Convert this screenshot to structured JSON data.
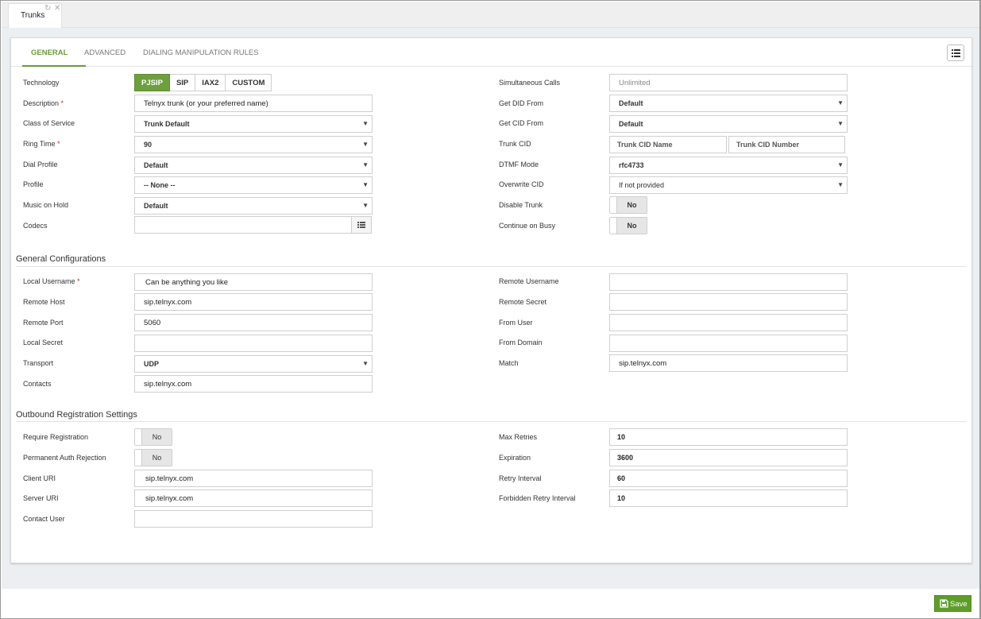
{
  "window": {
    "tab_title": "Trunks",
    "tab_icons": [
      "refresh-icon",
      "close-icon"
    ]
  },
  "tabs": [
    {
      "label": "GENERAL",
      "active": true
    },
    {
      "label": "ADVANCED",
      "active": false
    },
    {
      "label": "DIALING MANIPULATION RULES",
      "active": false
    }
  ],
  "left": {
    "technology": {
      "label": "Technology",
      "options": [
        "PJSIP",
        "SIP",
        "IAX2",
        "CUSTOM"
      ],
      "selected": "PJSIP"
    },
    "description": {
      "label": "Description",
      "required": "*",
      "value": "Telnyx trunk (or your preferred name)"
    },
    "class_of_service": {
      "label": "Class of Service",
      "value": "Trunk Default"
    },
    "ring_time": {
      "label": "Ring Time",
      "required": "*",
      "value": "90"
    },
    "dial_profile": {
      "label": "Dial Profile",
      "value": "Default"
    },
    "profile": {
      "label": "Profile",
      "value": "-- None --"
    },
    "music_on_hold": {
      "label": "Music on Hold",
      "value": "Default"
    },
    "codecs": {
      "label": "Codecs",
      "value": ""
    }
  },
  "right": {
    "simultaneous_calls": {
      "label": "Simultaneous Calls",
      "placeholder": "Unlimited"
    },
    "get_did_from": {
      "label": "Get DID From",
      "value": "Default"
    },
    "get_cid_from": {
      "label": "Get CID From",
      "value": "Default"
    },
    "trunk_cid": {
      "label": "Trunk CID",
      "name_placeholder": "Trunk CID Name",
      "number_placeholder": "Trunk CID Number"
    },
    "dtmf_mode": {
      "label": "DTMF Mode",
      "value": "rfc4733"
    },
    "overwrite_cid": {
      "label": "Overwrite CID",
      "value": "If not provided"
    },
    "disable_trunk": {
      "label": "Disable Trunk",
      "value": "No"
    },
    "continue_on_busy": {
      "label": "Continue on Busy",
      "value": "No"
    }
  },
  "general_config": {
    "title": "General Configurations",
    "local_username": {
      "label": "Local Username",
      "required": "*",
      "value": "Can be anything you like"
    },
    "remote_host": {
      "label": "Remote Host",
      "value": "sip.telnyx.com"
    },
    "remote_port": {
      "label": "Remote Port",
      "value": "5060"
    },
    "local_secret": {
      "label": "Local Secret",
      "value": ""
    },
    "transport": {
      "label": "Transport",
      "value": "UDP"
    },
    "contacts": {
      "label": "Contacts",
      "value": "sip.telnyx.com"
    },
    "remote_username": {
      "label": "Remote Username",
      "value": ""
    },
    "remote_secret": {
      "label": "Remote Secret",
      "value": ""
    },
    "from_user": {
      "label": "From User",
      "value": ""
    },
    "from_domain": {
      "label": "From Domain",
      "value": ""
    },
    "match": {
      "label": "Match",
      "value": "sip.telnyx.com"
    }
  },
  "outbound_reg": {
    "title": "Outbound Registration Settings",
    "require_registration": {
      "label": "Require Registration",
      "value": "No"
    },
    "permanent_auth_rejection": {
      "label": "Permanent Auth Rejection",
      "value": "No"
    },
    "client_uri": {
      "label": "Client URI",
      "value": "sip.telnyx.com"
    },
    "server_uri": {
      "label": "Server URI",
      "value": "sip.telnyx.com"
    },
    "contact_user": {
      "label": "Contact User",
      "value": ""
    },
    "max_retries": {
      "label": "Max Retries",
      "value": "10"
    },
    "expiration": {
      "label": "Expiration",
      "value": "3600"
    },
    "retry_interval": {
      "label": "Retry Interval",
      "value": "60"
    },
    "forbidden_retry_interval": {
      "label": "Forbidden Retry Interval",
      "value": "10"
    }
  },
  "footer": {
    "save_label": "Save"
  },
  "colors": {
    "accent": "#6e9f3f",
    "save": "#5f9d2b",
    "required": "#c9302c"
  }
}
